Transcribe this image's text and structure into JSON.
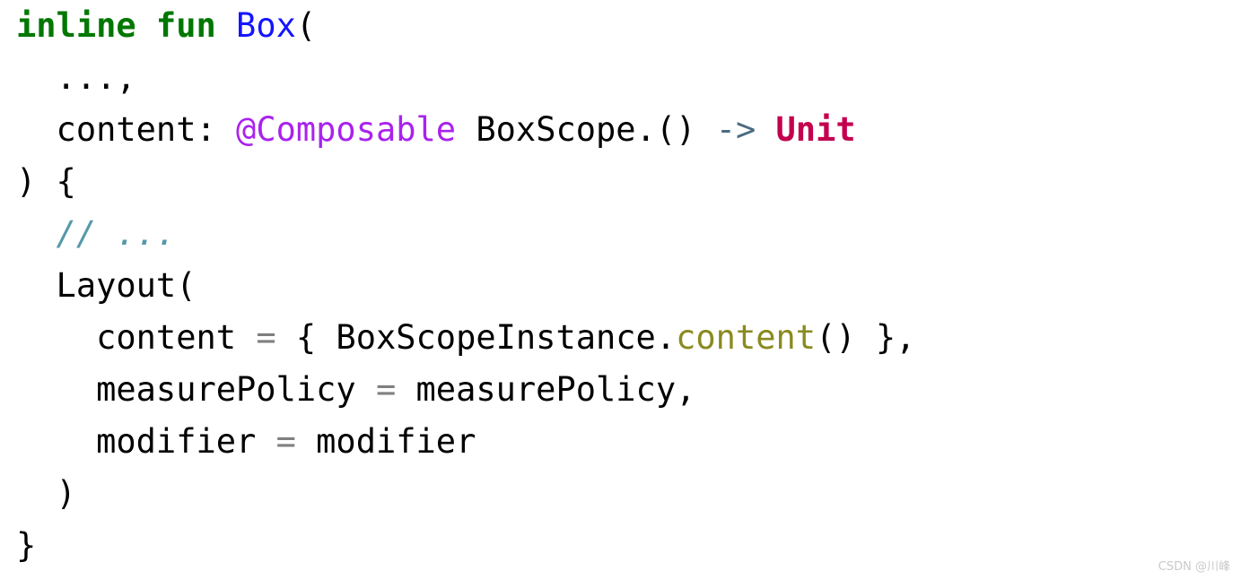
{
  "document": {
    "kind": "code-snippet",
    "language": "Kotlin",
    "background_color": "#ffffff",
    "colors": {
      "keyword": "#007700",
      "function": "#1515ff",
      "plain": "#000000",
      "annotation": "#aa22ee",
      "type": "#c3004e",
      "arrow": "#4a6b82",
      "comment": "#5599aa",
      "operator": "#808080",
      "member": "#8a8a20",
      "watermark": "#c9c9c9"
    }
  },
  "code": {
    "line1": {
      "keyword": "inline fun ",
      "function": "Box",
      "paren": "("
    },
    "line2": {
      "text": "  ...,"
    },
    "line3": {
      "param": "  content: ",
      "annotation": "@Composable",
      "receiver": " BoxScope.() ",
      "arrow": "->",
      "space": " ",
      "type": "Unit"
    },
    "line4": {
      "text": ") {"
    },
    "line5": {
      "comment": "  // ..."
    },
    "line6": {
      "text": "  Layout("
    },
    "line7": {
      "prefix": "    content ",
      "operator": "=",
      "brace_open": " { BoxScopeInstance.",
      "member": "content",
      "suffix": "() },"
    },
    "line8": {
      "prefix": "    measurePolicy ",
      "operator": "=",
      "suffix": " measurePolicy,"
    },
    "line9": {
      "prefix": "    modifier ",
      "operator": "=",
      "suffix": " modifier"
    },
    "line10": {
      "text": "  )"
    },
    "line11": {
      "text": "}"
    }
  },
  "watermark": {
    "text": "CSDN @川峰"
  }
}
